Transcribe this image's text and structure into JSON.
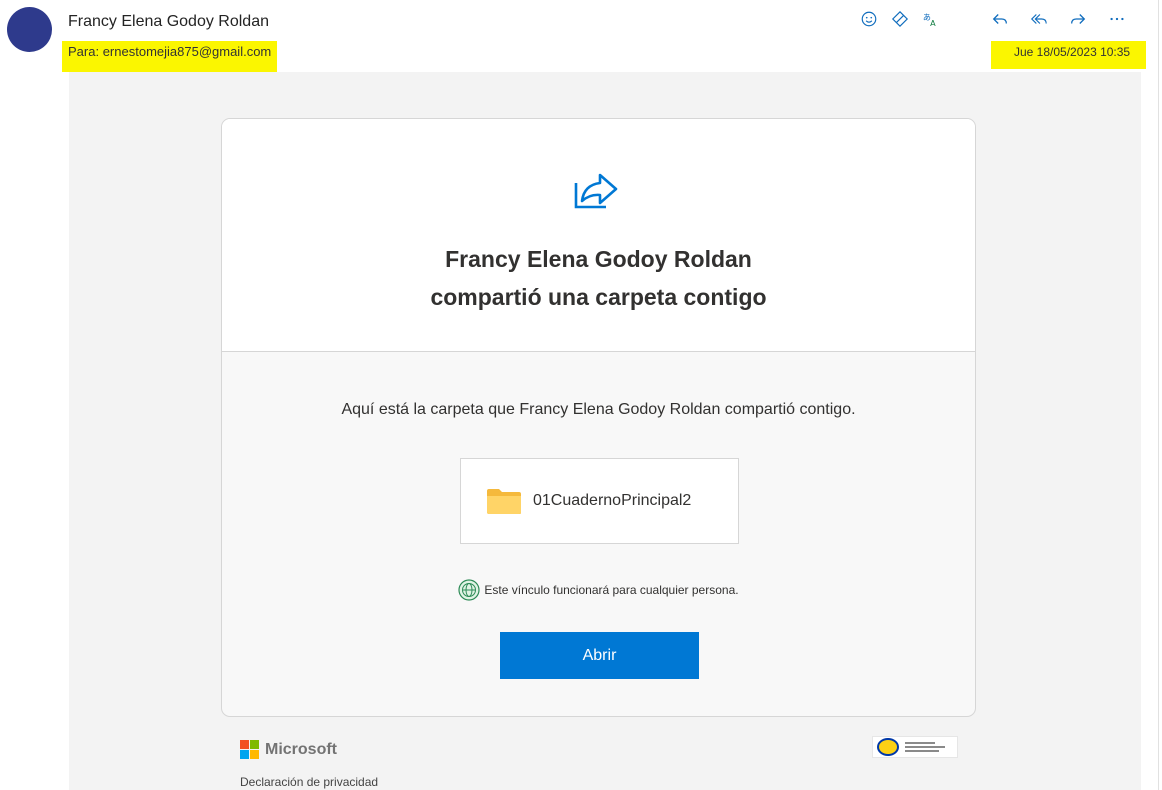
{
  "header": {
    "sender_name": "Francy Elena Godoy Roldan",
    "to_label": "Para:",
    "to_address": "ernestomejia875@gmail.com",
    "date": "Jue 18/05/2023 10:35"
  },
  "toolbar": {
    "icons": [
      "smiley-icon",
      "tag-icon",
      "translate-icon",
      "reply-icon",
      "reply-all-icon",
      "forward-icon",
      "more-icon"
    ]
  },
  "card": {
    "title_line1": "Francy Elena Godoy Roldan",
    "title_line2": "compartió una carpeta contigo",
    "description": "Aquí está la carpeta que Francy Elena Godoy Roldan compartió contigo.",
    "folder_name": "01CuadernoPrincipal2",
    "link_note": "Este vínculo funcionará para cualquier persona.",
    "open_button": "Abrir"
  },
  "footer": {
    "brand": "Microsoft",
    "privacy": "Declaración de privacidad"
  },
  "colors": {
    "highlight": "#fbf600",
    "accent": "#0078d4",
    "avatar": "#2e3a8c"
  }
}
